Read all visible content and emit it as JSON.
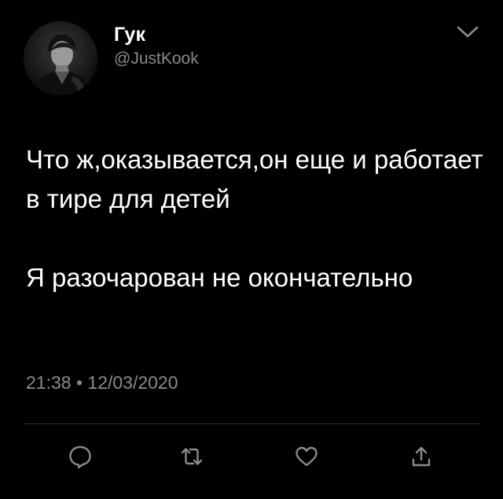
{
  "profile": {
    "display_name": "Гук",
    "handle": "@JustKook"
  },
  "tweet": {
    "paragraphs": [
      "Что ж,оказывается,он еще и работает в тире для детей",
      "Я разочарован не окончательно"
    ],
    "time": "21:38",
    "separator": "•",
    "date": "12/03/2020"
  },
  "icons": {
    "menu": "chevron-down-icon",
    "reply": "reply-icon",
    "retweet": "retweet-icon",
    "like": "heart-icon",
    "share": "share-icon"
  },
  "colors": {
    "background": "#000000",
    "text": "#ffffff",
    "secondary_text": "#8b8b8b",
    "divider": "#2f3336"
  }
}
